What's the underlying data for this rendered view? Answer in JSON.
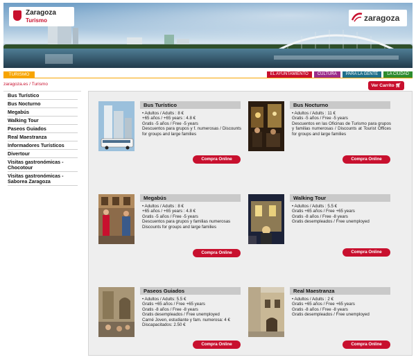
{
  "header": {
    "logo_line1": "Zaragoza",
    "logo_line2": "Turismo",
    "partner_logo": "zaragoza"
  },
  "nav": {
    "section_tab": "TURISMO",
    "links": [
      {
        "label": "EL AYUNTAMIENTO",
        "color": "#c8102e"
      },
      {
        "label": "CULTURA",
        "color": "#9b2c8a"
      },
      {
        "label": "PARA LA GENTE",
        "color": "#1f6f8b"
      },
      {
        "label": "LA CIUDAD",
        "color": "#2e8b2e"
      }
    ]
  },
  "breadcrumb": "zaragoza.es / Turismo",
  "cart_label": "Ver Carrito",
  "sidebar": {
    "items": [
      "Bus Turístico",
      "Bus Nocturno",
      "Megabús",
      "Walking Tour",
      "Paseos Guiados",
      "Real Maestranza",
      "Informadores Turísticos",
      "Divertour",
      "Visitas gastronómicas - Chocotour",
      "Visitas gastronómicas - Saborea Zaragoza"
    ]
  },
  "buy_label": "Compra Online",
  "products": [
    {
      "name": "Bus Turístico",
      "lines": [
        "• Adultos / Adults : 8 €",
        "+65 años / +65 years : 4.8 €",
        "Gratis -5 años / Free -5 years",
        "Descuentos para grupos y f. numerosas / Discounts for groups and large families"
      ]
    },
    {
      "name": "Bus Nocturno",
      "lines": [
        "• Adultos / Adults : 11 €",
        "Gratis -5 años / Free -5 years",
        "Descuentos en las Oficinas de Turismo para grupos y familias numerosas / Discounts at Tourist Offices for groups and large families"
      ]
    },
    {
      "name": "Megabús",
      "lines": [
        "• Adultos / Adults : 8 €",
        "+65 años / +65 years : 4.8 €",
        "Gratis -5 años / Free -5 years",
        "Descuentos para grupos y familias numerosas",
        "Discounts for groups and large families"
      ]
    },
    {
      "name": "Walking Tour",
      "lines": [
        "• Adultos / Adults : 5.5 €",
        "Gratis +65 años / Free +65 years",
        "Gratis -8 años / Free -8 years",
        "Gratis desempleados / Free unemployed"
      ]
    },
    {
      "name": "Paseos Guiados",
      "lines": [
        "• Adultos / Adults: 5.5 €",
        "Gratis +65 años / Free +65 years",
        "Gratis -8 años / Free -8 years",
        "Gratis desempleados / Free unemployed",
        "Carné Joven, estudiante y fam. numerosa: 4 €",
        "Discapacitados: 2.50 €"
      ]
    },
    {
      "name": "Real Maestranza",
      "lines": [
        "• Adultos / Adults : 2 €",
        "Gratis +65 años / Free +65 years",
        "Gratis -8 años / Free -8 years",
        "Gratis desempleados / Free unemployed"
      ]
    }
  ]
}
